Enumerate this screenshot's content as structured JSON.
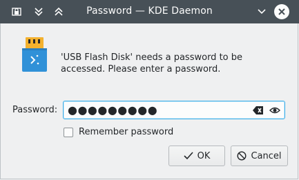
{
  "window": {
    "title": "Password — KDE Daemon"
  },
  "titlebar_icons": {
    "left": [
      "keep-above-icon",
      "shade-icon",
      "keep-on-top-icon"
    ],
    "right": [
      "minimize-icon",
      "close-icon"
    ]
  },
  "dialog": {
    "icon": "usb-flash-disk-icon",
    "message": "'USB Flash Disk' needs a password to be accessed. Please enter a password.",
    "password_label": "Password:",
    "password_value": "●●●●●●●●●",
    "remember_label": "Remember password",
    "remember_checked": false
  },
  "buttons": {
    "ok_label": "OK",
    "cancel_label": "Cancel"
  },
  "colors": {
    "titlebar": "#475057",
    "accent": "#3daee9",
    "usb_blue": "#3091d8",
    "usb_connector": "#f3b12e"
  }
}
